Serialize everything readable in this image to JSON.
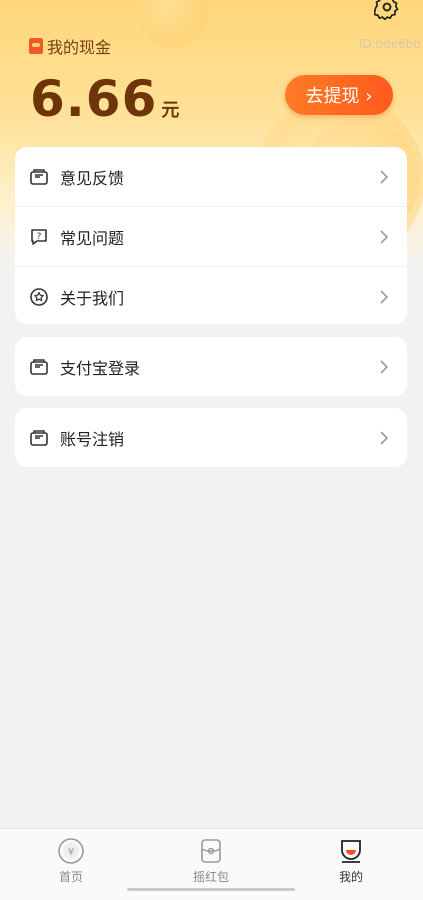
{
  "header": {
    "title": "我的现金",
    "user_id": "ID:bde6bb",
    "amount": "6.66",
    "unit": "元",
    "withdraw_label": "去提现 ›"
  },
  "menu": {
    "group1": [
      {
        "label": "意见反馈",
        "icon": "feedback-envelope-icon"
      },
      {
        "label": "常见问题",
        "icon": "question-chat-icon"
      },
      {
        "label": "关于我们",
        "icon": "star-badge-icon"
      }
    ],
    "alipay": {
      "label": "支付宝登录",
      "icon": "envelope-icon"
    },
    "logout": {
      "label": "账号注销",
      "icon": "envelope-icon"
    }
  },
  "tabbar": {
    "home": "首页",
    "shake": "摇红包",
    "mine": "我的"
  },
  "colors": {
    "accent": "#ff5a1c",
    "amount_text": "#6e3508",
    "header_bg": "#ffd77a"
  }
}
